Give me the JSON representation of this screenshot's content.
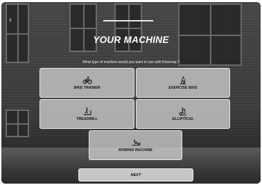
{
  "header": {
    "back_glyph": "‹",
    "title": "YOUR MACHINE",
    "subtitle": "What type of machine would you want to use with Kinomap ?"
  },
  "machines": [
    {
      "label": "BIKE TRAINER",
      "icon": "bike-trainer-icon"
    },
    {
      "label": "EXERCISE BIKE",
      "icon": "exercise-bike-icon"
    },
    {
      "label": "TREADMILL",
      "icon": "treadmill-icon"
    },
    {
      "label": "ELLIPTICAL",
      "icon": "elliptical-icon"
    },
    {
      "label": "ROWING MACHINE",
      "icon": "rowing-machine-icon"
    }
  ],
  "footer": {
    "next_label": "NEXT"
  }
}
